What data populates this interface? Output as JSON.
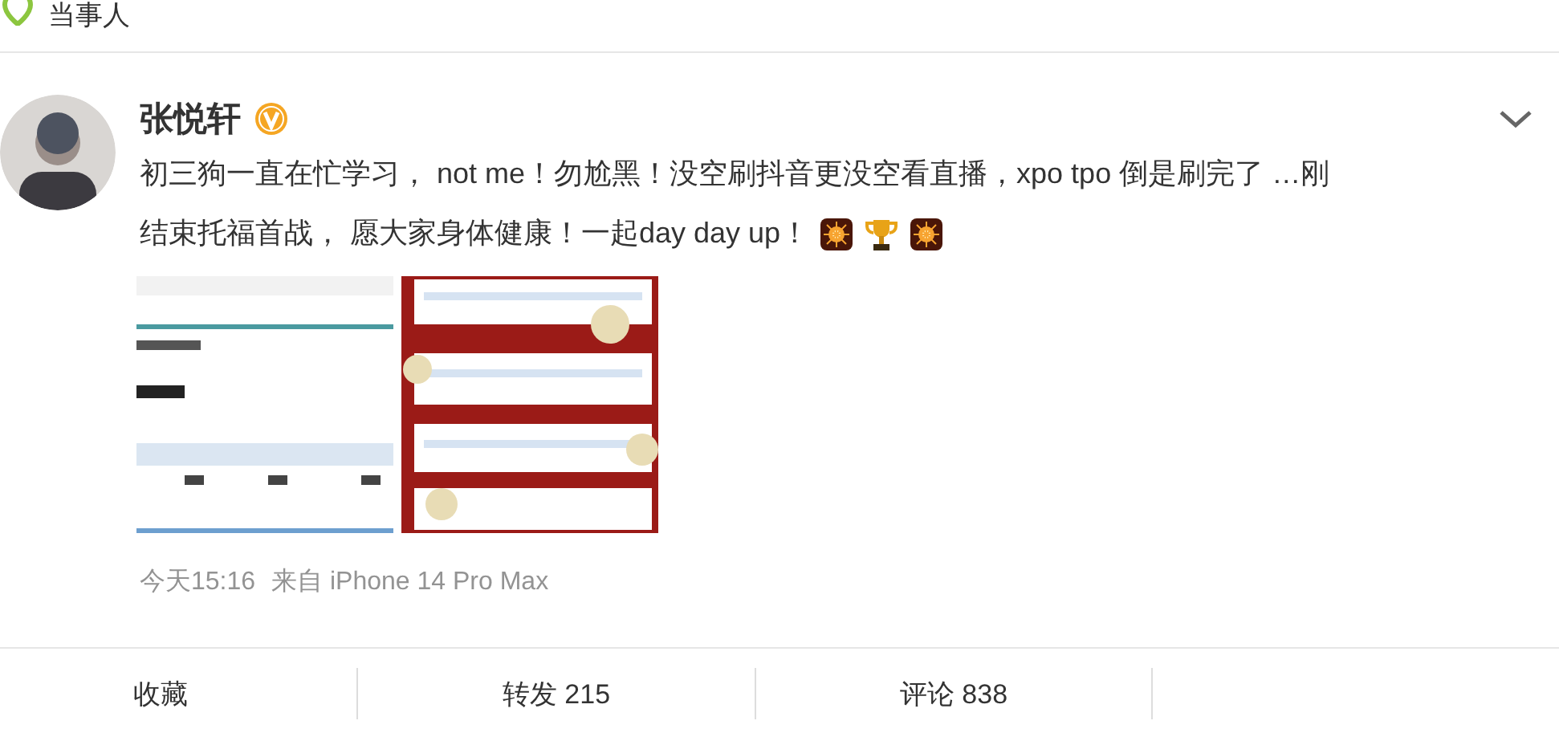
{
  "header": {
    "label": "当事人"
  },
  "post": {
    "author": "张悦轩",
    "verified": true,
    "text_lines": [
      "初三狗一直在忙学习， not me！勿尬黑！没空刷抖音更没空看直播，xpo tpo 倒是刷完了 …刚",
      "结束托福首战， 愿大家身体健康！一起day day up！"
    ],
    "emojis": [
      {
        "kind": "firework"
      },
      {
        "kind": "trophy"
      },
      {
        "kind": "firework"
      }
    ],
    "images": [
      {
        "kind": "picture"
      },
      {
        "kind": "picture"
      }
    ],
    "time": "今天15:16",
    "source": "来自 iPhone 14 Pro Max"
  },
  "actions": [
    {
      "label": "收藏"
    },
    {
      "label": "转发 215"
    },
    {
      "label": "评论 838"
    }
  ]
}
